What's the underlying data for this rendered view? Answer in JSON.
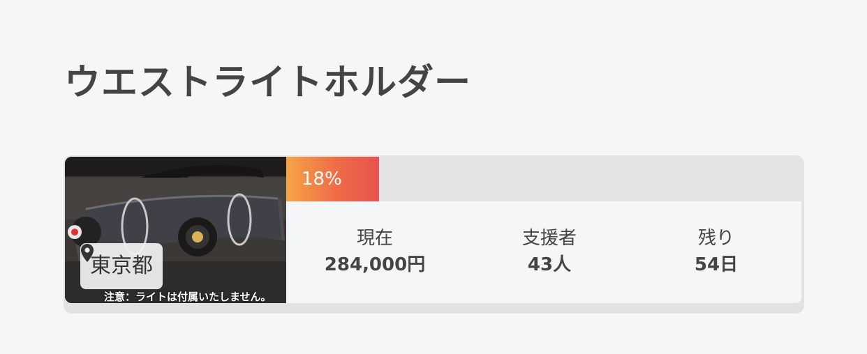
{
  "project": {
    "title": "ウエストライトホルダー",
    "location": "東京都",
    "photo_caption": "注意：ライトは付属いたしません。",
    "progress_percent": 18,
    "progress_label": "18%",
    "stats": [
      {
        "label": "現在",
        "value": "284,000円"
      },
      {
        "label": "支援者",
        "value": "43人"
      },
      {
        "label": "残り",
        "value": "54日"
      }
    ]
  },
  "colors": {
    "progress_start": "#f5a447",
    "progress_end": "#e8534f",
    "card_bg": "#e2e2e2",
    "page_bg": "#f5f6f8"
  },
  "icons": {
    "location": "map-pin-icon"
  }
}
